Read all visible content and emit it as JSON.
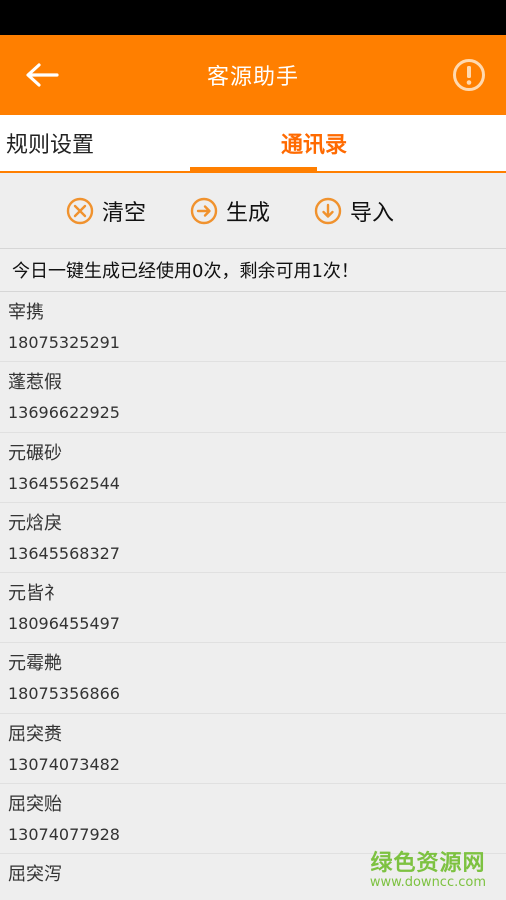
{
  "app_bar": {
    "title": "客源助手",
    "back_icon": "arrow-left-icon",
    "info_icon": "exclamation-circle-icon",
    "color": "#ff7f00"
  },
  "tabs": [
    {
      "label": "规则设置",
      "active": false
    },
    {
      "label": "通讯录",
      "active": true
    }
  ],
  "toolbar": {
    "clear_label": "清空",
    "generate_label": "生成",
    "import_label": "导入"
  },
  "notice": "今日一键生成已经使用0次，剩余可用1次！",
  "contacts": [
    {
      "name": "宰携",
      "phone": "18075325291"
    },
    {
      "name": "蓬惹假",
      "phone": "13696622925"
    },
    {
      "name": "元碾砂",
      "phone": "13645562544"
    },
    {
      "name": "元焓戾",
      "phone": "13645568327"
    },
    {
      "name": "元皆礻",
      "phone": "18096455497"
    },
    {
      "name": "元霉艴",
      "phone": "18075356866"
    },
    {
      "name": "屈突赉",
      "phone": "13074073482"
    },
    {
      "name": "屈突贻",
      "phone": "13074077928"
    },
    {
      "name": "屈突泻",
      "phone": ""
    }
  ],
  "watermark": {
    "main": "绿色资源网",
    "sub": "www.downcc.com"
  }
}
